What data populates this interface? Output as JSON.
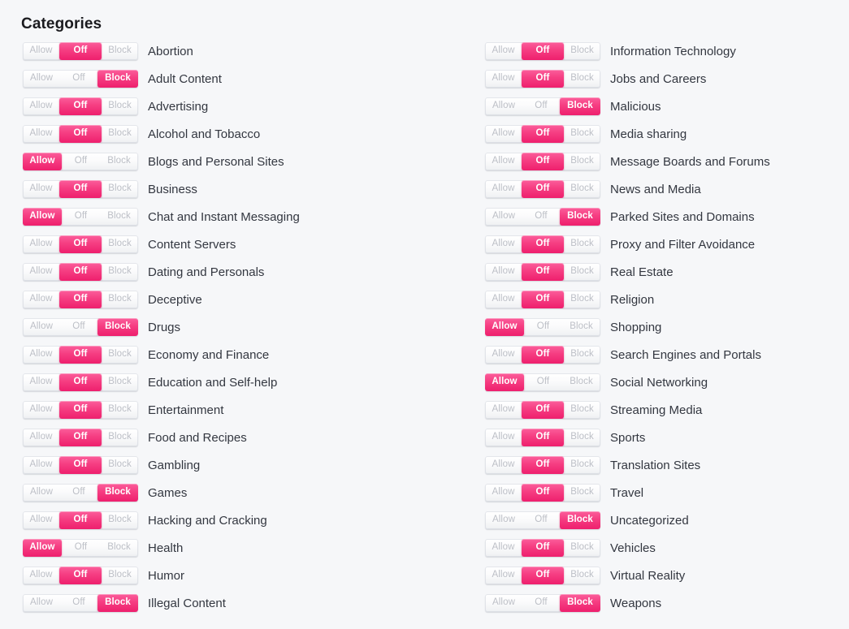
{
  "page": {
    "title": "Categories",
    "background_color": "#f6f7f9",
    "accent_color": "#f4377f",
    "label_color": "#333740",
    "inactive_label_color": "#bcbfc6"
  },
  "toggle": {
    "options": [
      "Allow",
      "Off",
      "Block"
    ],
    "allow_label": "Allow",
    "off_label": "Off",
    "block_label": "Block"
  },
  "columns": [
    {
      "name": "left",
      "rows": [
        {
          "label": "Abortion",
          "state": "off"
        },
        {
          "label": "Adult Content",
          "state": "block"
        },
        {
          "label": "Advertising",
          "state": "off"
        },
        {
          "label": "Alcohol and Tobacco",
          "state": "off"
        },
        {
          "label": "Blogs and Personal Sites",
          "state": "allow"
        },
        {
          "label": "Business",
          "state": "off"
        },
        {
          "label": "Chat and Instant Messaging",
          "state": "allow"
        },
        {
          "label": "Content Servers",
          "state": "off"
        },
        {
          "label": "Dating and Personals",
          "state": "off"
        },
        {
          "label": "Deceptive",
          "state": "off"
        },
        {
          "label": "Drugs",
          "state": "block"
        },
        {
          "label": "Economy and Finance",
          "state": "off"
        },
        {
          "label": "Education and Self-help",
          "state": "off"
        },
        {
          "label": "Entertainment",
          "state": "off"
        },
        {
          "label": "Food and Recipes",
          "state": "off"
        },
        {
          "label": "Gambling",
          "state": "off"
        },
        {
          "label": "Games",
          "state": "block"
        },
        {
          "label": "Hacking and Cracking",
          "state": "off"
        },
        {
          "label": "Health",
          "state": "allow"
        },
        {
          "label": "Humor",
          "state": "off"
        },
        {
          "label": "Illegal Content",
          "state": "block"
        }
      ]
    },
    {
      "name": "right",
      "rows": [
        {
          "label": "Information Technology",
          "state": "off"
        },
        {
          "label": "Jobs and Careers",
          "state": "off"
        },
        {
          "label": "Malicious",
          "state": "block"
        },
        {
          "label": "Media sharing",
          "state": "off"
        },
        {
          "label": "Message Boards and Forums",
          "state": "off"
        },
        {
          "label": "News and Media",
          "state": "off"
        },
        {
          "label": "Parked Sites and Domains",
          "state": "block"
        },
        {
          "label": "Proxy and Filter Avoidance",
          "state": "off"
        },
        {
          "label": "Real Estate",
          "state": "off"
        },
        {
          "label": "Religion",
          "state": "off"
        },
        {
          "label": "Shopping",
          "state": "allow"
        },
        {
          "label": "Search Engines and Portals",
          "state": "off"
        },
        {
          "label": "Social Networking",
          "state": "allow"
        },
        {
          "label": "Streaming Media",
          "state": "off"
        },
        {
          "label": "Sports",
          "state": "off"
        },
        {
          "label": "Translation Sites",
          "state": "off"
        },
        {
          "label": "Travel",
          "state": "off"
        },
        {
          "label": "Uncategorized",
          "state": "block"
        },
        {
          "label": "Vehicles",
          "state": "off"
        },
        {
          "label": "Virtual Reality",
          "state": "off"
        },
        {
          "label": "Weapons",
          "state": "block"
        }
      ]
    }
  ]
}
